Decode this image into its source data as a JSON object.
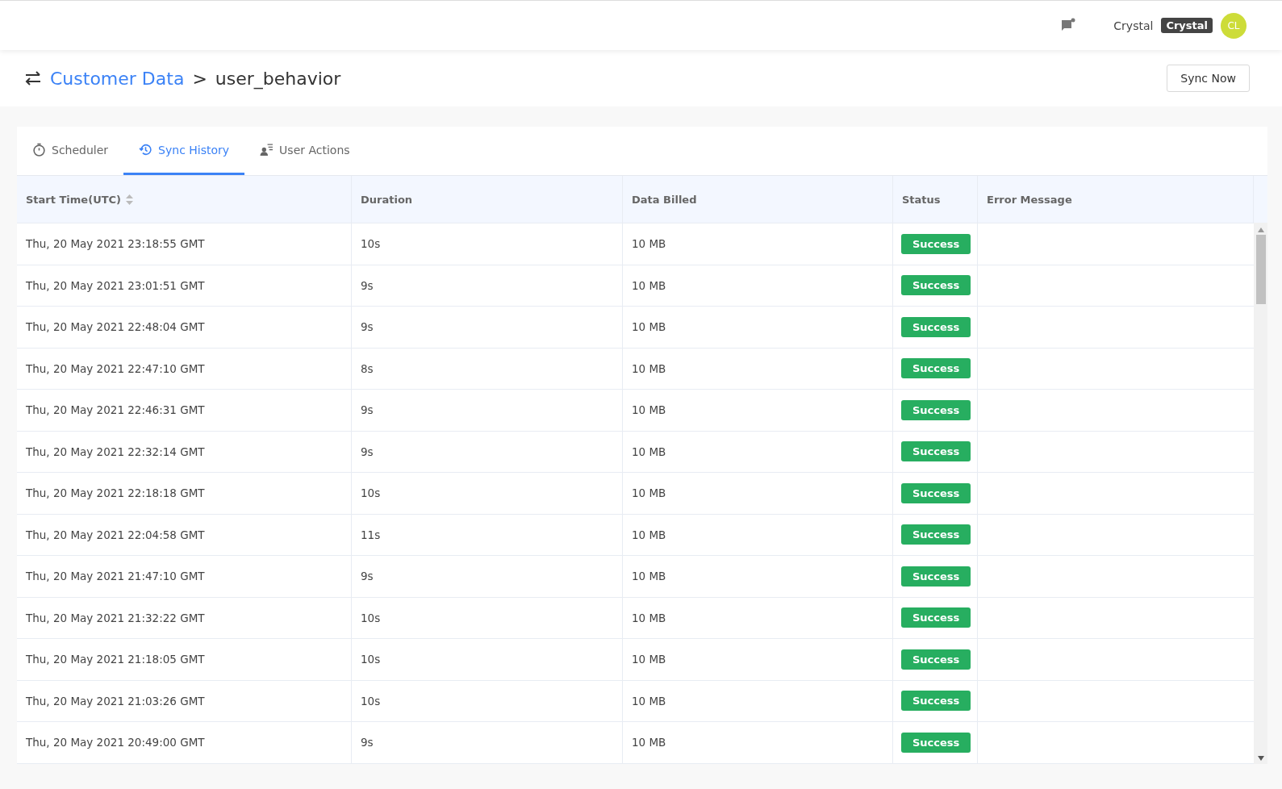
{
  "header": {
    "user_name": "Crystal",
    "user_tag": "Crystal",
    "avatar_initials": "CL"
  },
  "breadcrumb": {
    "parent": "Customer Data",
    "separator": ">",
    "current": "user_behavior"
  },
  "sync_button": "Sync Now",
  "tabs": [
    {
      "label": "Scheduler",
      "selected": false
    },
    {
      "label": "Sync History",
      "selected": true
    },
    {
      "label": "User Actions",
      "selected": false
    }
  ],
  "table": {
    "columns": [
      {
        "label": "Start Time(UTC)",
        "sortable": true
      },
      {
        "label": "Duration",
        "sortable": false
      },
      {
        "label": "Data Billed",
        "sortable": false
      },
      {
        "label": "Status",
        "sortable": false
      },
      {
        "label": "Error Message",
        "sortable": false
      }
    ],
    "rows": [
      {
        "start": "Thu, 20 May 2021 23:18:55 GMT",
        "duration": "10s",
        "data": "10 MB",
        "status": "Success"
      },
      {
        "start": "Thu, 20 May 2021 23:01:51 GMT",
        "duration": "9s",
        "data": "10 MB",
        "status": "Success"
      },
      {
        "start": "Thu, 20 May 2021 22:48:04 GMT",
        "duration": "9s",
        "data": "10 MB",
        "status": "Success"
      },
      {
        "start": "Thu, 20 May 2021 22:47:10 GMT",
        "duration": "8s",
        "data": "10 MB",
        "status": "Success"
      },
      {
        "start": "Thu, 20 May 2021 22:46:31 GMT",
        "duration": "9s",
        "data": "10 MB",
        "status": "Success"
      },
      {
        "start": "Thu, 20 May 2021 22:32:14 GMT",
        "duration": "9s",
        "data": "10 MB",
        "status": "Success"
      },
      {
        "start": "Thu, 20 May 2021 22:18:18 GMT",
        "duration": "10s",
        "data": "10 MB",
        "status": "Success"
      },
      {
        "start": "Thu, 20 May 2021 22:04:58 GMT",
        "duration": "11s",
        "data": "10 MB",
        "status": "Success"
      },
      {
        "start": "Thu, 20 May 2021 21:47:10 GMT",
        "duration": "9s",
        "data": "10 MB",
        "status": "Success"
      },
      {
        "start": "Thu, 20 May 2021 21:32:22 GMT",
        "duration": "10s",
        "data": "10 MB",
        "status": "Success"
      },
      {
        "start": "Thu, 20 May 2021 21:18:05 GMT",
        "duration": "10s",
        "data": "10 MB",
        "status": "Success"
      },
      {
        "start": "Thu, 20 May 2021 21:03:26 GMT",
        "duration": "10s",
        "data": "10 MB",
        "status": "Success"
      },
      {
        "start": "Thu, 20 May 2021 20:49:00 GMT",
        "duration": "9s",
        "data": "10 MB",
        "status": "Success"
      }
    ]
  }
}
